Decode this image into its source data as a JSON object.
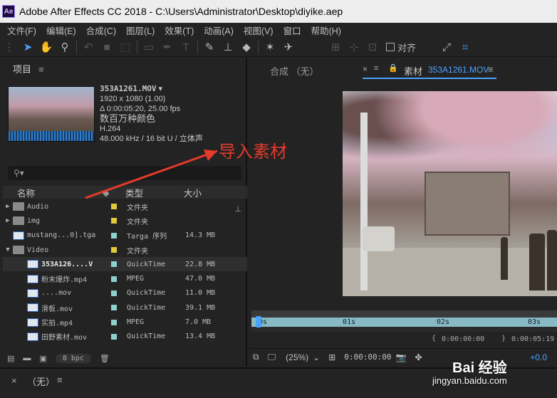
{
  "window": {
    "title": "Adobe After Effects CC 2018 - C:\\Users\\Administrator\\Desktop\\diyike.aep",
    "logo_text": "Ae"
  },
  "menu": [
    "文件(F)",
    "编辑(E)",
    "合成(C)",
    "图层(L)",
    "效果(T)",
    "动画(A)",
    "视图(V)",
    "窗口",
    "帮助(H)"
  ],
  "toolbar": {
    "align_label": "对齐"
  },
  "project": {
    "tab_label": "项目",
    "selected_file": {
      "name": "353A1261.MOV",
      "resolution": "1920 x 1080 (1.00)",
      "duration": "Δ 0:00:05:20, 25.00 fps",
      "colors": "数百万种颜色",
      "codec": "H.264",
      "audio_info": "48.000 kHz / 16 bit U / 立体声"
    },
    "columns": {
      "name": "名称",
      "type": "类型",
      "size": "大小"
    },
    "rows": [
      {
        "name": "Audio",
        "type": "文件夹",
        "size": "",
        "kind": "folder",
        "expanded": false,
        "swatch": "#e0c93a"
      },
      {
        "name": "img",
        "type": "文件夹",
        "size": "",
        "kind": "folder",
        "expanded": false,
        "swatch": "#e0c93a"
      },
      {
        "name": "mustang...0].tga",
        "type": "Targa 序列",
        "size": "14.3 MB",
        "kind": "seq",
        "swatch": "#8fd0cc"
      },
      {
        "name": "Video",
        "type": "文件夹",
        "size": "",
        "kind": "folder",
        "expanded": true,
        "swatch": "#e0c93a"
      },
      {
        "name": "353A126....V",
        "type": "QuickTime",
        "size": "22.8 MB",
        "kind": "file",
        "selected": true,
        "swatch": "#8fd0cc"
      },
      {
        "name": "粉末爆炸.mp4",
        "type": "MPEG",
        "size": "47.0 MB",
        "kind": "file",
        "swatch": "#8fd0cc"
      },
      {
        "name": "....mov",
        "type": "QuickTime",
        "size": "11.0 MB",
        "kind": "file",
        "swatch": "#8fd0cc"
      },
      {
        "name": "滑板.mov",
        "type": "QuickTime",
        "size": "39.1 MB",
        "kind": "file",
        "swatch": "#8fd0cc"
      },
      {
        "name": "实拍.mp4",
        "type": "MPEG",
        "size": "7.0 MB",
        "kind": "file",
        "swatch": "#8fd0cc"
      },
      {
        "name": "田野素材.mov",
        "type": "QuickTime",
        "size": "13.4 MB",
        "kind": "file",
        "swatch": "#8fd0cc"
      }
    ],
    "bpc_label": "8 bpc"
  },
  "viewer": {
    "comp_tab": "合成 （无）",
    "footage_tab_prefix": "素材",
    "footage_tab_name": "353A1261.MOV",
    "ruler_ticks": [
      "0s",
      "01s",
      "02s",
      "03s"
    ],
    "in_time": "0:00:00:00",
    "out_time": "0:00:05:19",
    "zoom": "(25%)",
    "current_time": "0:00:00:00",
    "offset": "+0.0"
  },
  "annotation": "导入素材",
  "timeline": {
    "tab_label": "（无）"
  },
  "watermark": {
    "brand": "Bai 经验",
    "url": "jingyan.baidu.com"
  },
  "colors": {
    "accent": "#4aa3ff",
    "annotation": "#e53a2c"
  }
}
